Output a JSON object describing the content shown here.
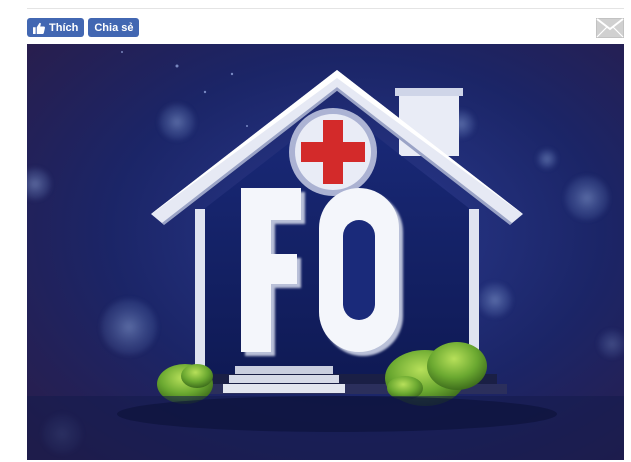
{
  "social": {
    "like_label": "Thích",
    "share_label": "Chia sẻ"
  },
  "image": {
    "title_text": "F0"
  },
  "colors": {
    "facebook_blue": "#4267b2",
    "mail_icon": "#c8c8c8",
    "background_navy": "#1b2567",
    "cross_red": "#d32a2a"
  },
  "icons": {
    "like": "thumbs-up-icon",
    "mail": "mail-icon"
  }
}
